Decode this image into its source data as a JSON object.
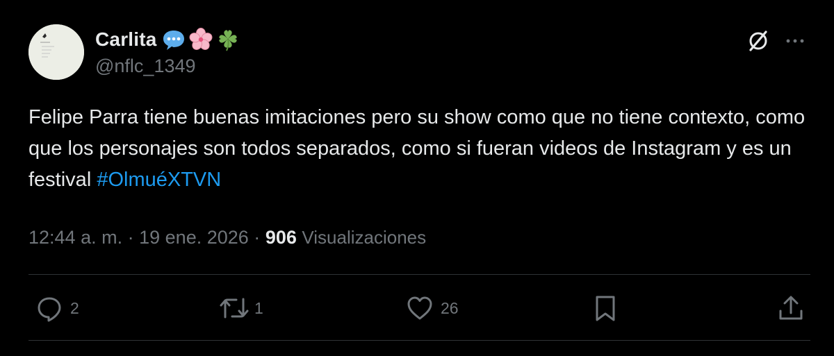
{
  "user": {
    "display_name": "Carlita",
    "emojis": [
      "speech-bubble-emoji",
      "cherry-blossom-emoji",
      "four-leaf-clover-emoji"
    ],
    "handle": "@nflc_1349"
  },
  "tweet": {
    "text": "Felipe Parra tiene buenas imitaciones pero su show como que no tiene contexto, como que los personajes son todos separados, como si fueran videos de Instagram y es un festival ",
    "hashtag": "#OlmuéXTVN"
  },
  "meta": {
    "time": "12:44 a. m.",
    "date": "19 ene. 2026",
    "separator": "·",
    "views_count": "906",
    "views_label": "Visualizaciones"
  },
  "actions": {
    "replies": "2",
    "reposts": "1",
    "likes": "26"
  },
  "colors": {
    "background": "#000000",
    "text": "#e7e9ea",
    "secondary": "#71767b",
    "link": "#1d9bf0",
    "divider": "#2f3336"
  }
}
